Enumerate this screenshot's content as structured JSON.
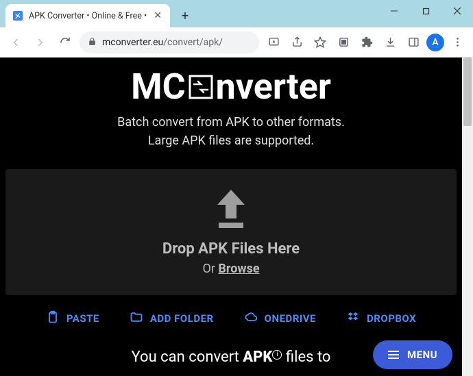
{
  "window": {
    "tab_title": "APK Converter • Online & Free •",
    "url_domain": "mconverter.eu",
    "url_path": "/convert/apk/",
    "avatar_letter": "A"
  },
  "page": {
    "logo_left": "MC",
    "logo_right": "nverter",
    "subtitle_line1": "Batch convert from APK to other formats.",
    "subtitle_line2": "Large APK files are supported.",
    "drop_title": "Drop APK Files Here",
    "drop_or_prefix": "Or ",
    "drop_browse": "Browse",
    "actions": {
      "paste": "PASTE",
      "add_folder": "ADD FOLDER",
      "onedrive": "ONEDRIVE",
      "dropbox": "DROPBOX"
    },
    "footer_prefix": "You can convert ",
    "footer_apk": "APK",
    "footer_suffix": " files to",
    "menu_label": "MENU"
  }
}
